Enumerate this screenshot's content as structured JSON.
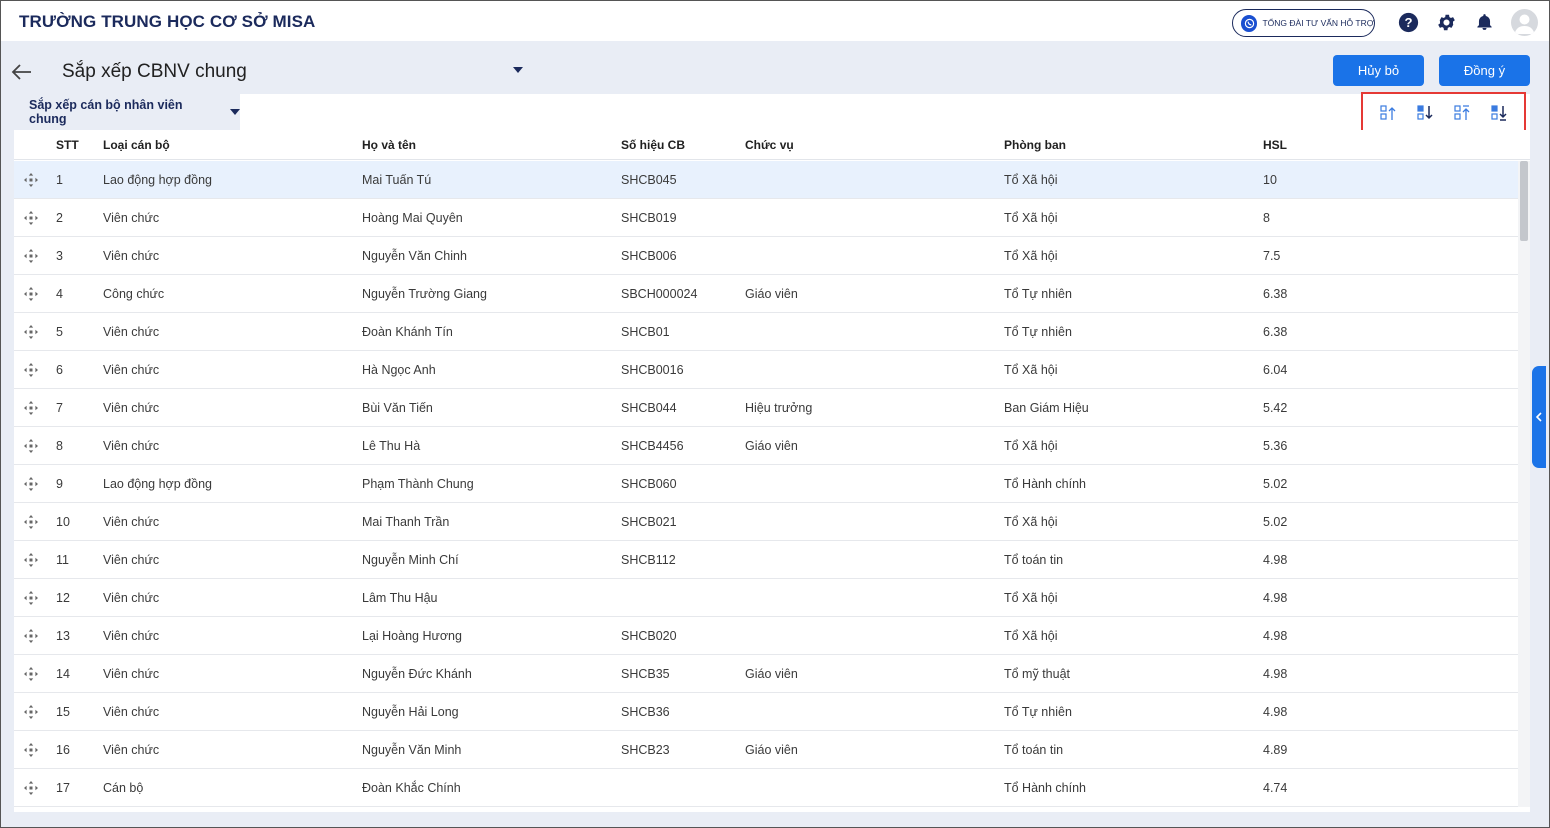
{
  "header": {
    "school_name": "TRƯỜNG TRUNG HỌC CƠ SỞ MISA",
    "support_label": "TỔNG ĐÀI TƯ VẤN HỖ TRỢ"
  },
  "page": {
    "title": "Sắp xếp CBNV chung",
    "cancel_label": "Hủy bỏ",
    "ok_label": "Đồng ý",
    "tab_label": "Sắp xếp cán bộ nhân viên chung"
  },
  "table": {
    "columns": {
      "stt": "STT",
      "type": "Loại cán bộ",
      "name": "Họ và tên",
      "code": "Số hiệu CB",
      "position": "Chức vụ",
      "dept": "Phòng ban",
      "hsl": "HSL"
    },
    "rows": [
      {
        "stt": "1",
        "type": "Lao động hợp đồng",
        "name": "Mai Tuấn Tú",
        "code": "SHCB045",
        "position": "",
        "dept": "Tổ Xã hội",
        "hsl": "10"
      },
      {
        "stt": "2",
        "type": "Viên chức",
        "name": "Hoàng Mai Quyên",
        "code": "SHCB019",
        "position": "",
        "dept": "Tổ Xã hội",
        "hsl": "8"
      },
      {
        "stt": "3",
        "type": "Viên chức",
        "name": "Nguyễn Văn Chinh",
        "code": "SHCB006",
        "position": "",
        "dept": "Tổ Xã hội",
        "hsl": "7.5"
      },
      {
        "stt": "4",
        "type": "Công chức",
        "name": "Nguyễn Trường Giang",
        "code": "SBCH000024",
        "position": "Giáo viên",
        "dept": "Tổ Tự nhiên",
        "hsl": "6.38"
      },
      {
        "stt": "5",
        "type": "Viên chức",
        "name": "Đoàn Khánh Tín",
        "code": "SHCB01",
        "position": "",
        "dept": "Tổ Tự nhiên",
        "hsl": "6.38"
      },
      {
        "stt": "6",
        "type": "Viên chức",
        "name": "Hà Ngọc Anh",
        "code": "SHCB0016",
        "position": "",
        "dept": "Tổ Xã hội",
        "hsl": "6.04"
      },
      {
        "stt": "7",
        "type": "Viên chức",
        "name": "Bùi Văn Tiến",
        "code": "SHCB044",
        "position": "Hiệu trưởng",
        "dept": "Ban Giám Hiệu",
        "hsl": "5.42"
      },
      {
        "stt": "8",
        "type": "Viên chức",
        "name": "Lê Thu Hà",
        "code": "SHCB4456",
        "position": "Giáo viên",
        "dept": "Tổ Xã hội",
        "hsl": "5.36"
      },
      {
        "stt": "9",
        "type": "Lao động hợp đồng",
        "name": "Phạm Thành Chung",
        "code": "SHCB060",
        "position": "",
        "dept": "Tổ Hành chính",
        "hsl": "5.02"
      },
      {
        "stt": "10",
        "type": "Viên chức",
        "name": "Mai Thanh Trần",
        "code": "SHCB021",
        "position": "",
        "dept": "Tổ Xã hội",
        "hsl": "5.02"
      },
      {
        "stt": "11",
        "type": "Viên chức",
        "name": "Nguyễn Minh Chí",
        "code": "SHCB112",
        "position": "",
        "dept": "Tổ toán tin",
        "hsl": "4.98"
      },
      {
        "stt": "12",
        "type": "Viên chức",
        "name": "Lâm Thu Hậu",
        "code": "",
        "position": "",
        "dept": "Tổ Xã hội",
        "hsl": "4.98"
      },
      {
        "stt": "13",
        "type": "Viên chức",
        "name": "Lại Hoàng Hương",
        "code": "SHCB020",
        "position": "",
        "dept": "Tổ Xã hội",
        "hsl": "4.98"
      },
      {
        "stt": "14",
        "type": "Viên chức",
        "name": "Nguyễn Đức Khánh",
        "code": "SHCB35",
        "position": "Giáo viên",
        "dept": "Tổ mỹ thuật",
        "hsl": "4.98"
      },
      {
        "stt": "15",
        "type": "Viên chức",
        "name": "Nguyễn Hải Long",
        "code": "SHCB36",
        "position": "",
        "dept": "Tổ Tự nhiên",
        "hsl": "4.98"
      },
      {
        "stt": "16",
        "type": "Viên chức",
        "name": "Nguyễn Văn Minh",
        "code": "SHCB23",
        "position": "Giáo viên",
        "dept": "Tổ toán tin",
        "hsl": "4.89"
      },
      {
        "stt": "17",
        "type": "Cán bộ",
        "name": "Đoàn Khắc Chính",
        "code": "",
        "position": "",
        "dept": "Tổ Hành chính",
        "hsl": "4.74"
      }
    ]
  },
  "colors": {
    "primary": "#1a73e8",
    "navy": "#1b2a5c",
    "highlight_border": "#e53935",
    "selected_row": "#e8f1fd"
  },
  "icons": {
    "back": "arrow-left-icon",
    "sort_tools": [
      "move-up-icon",
      "move-down-icon",
      "move-top-icon",
      "move-bottom-icon"
    ],
    "row_handle": "drag-move-icon"
  }
}
